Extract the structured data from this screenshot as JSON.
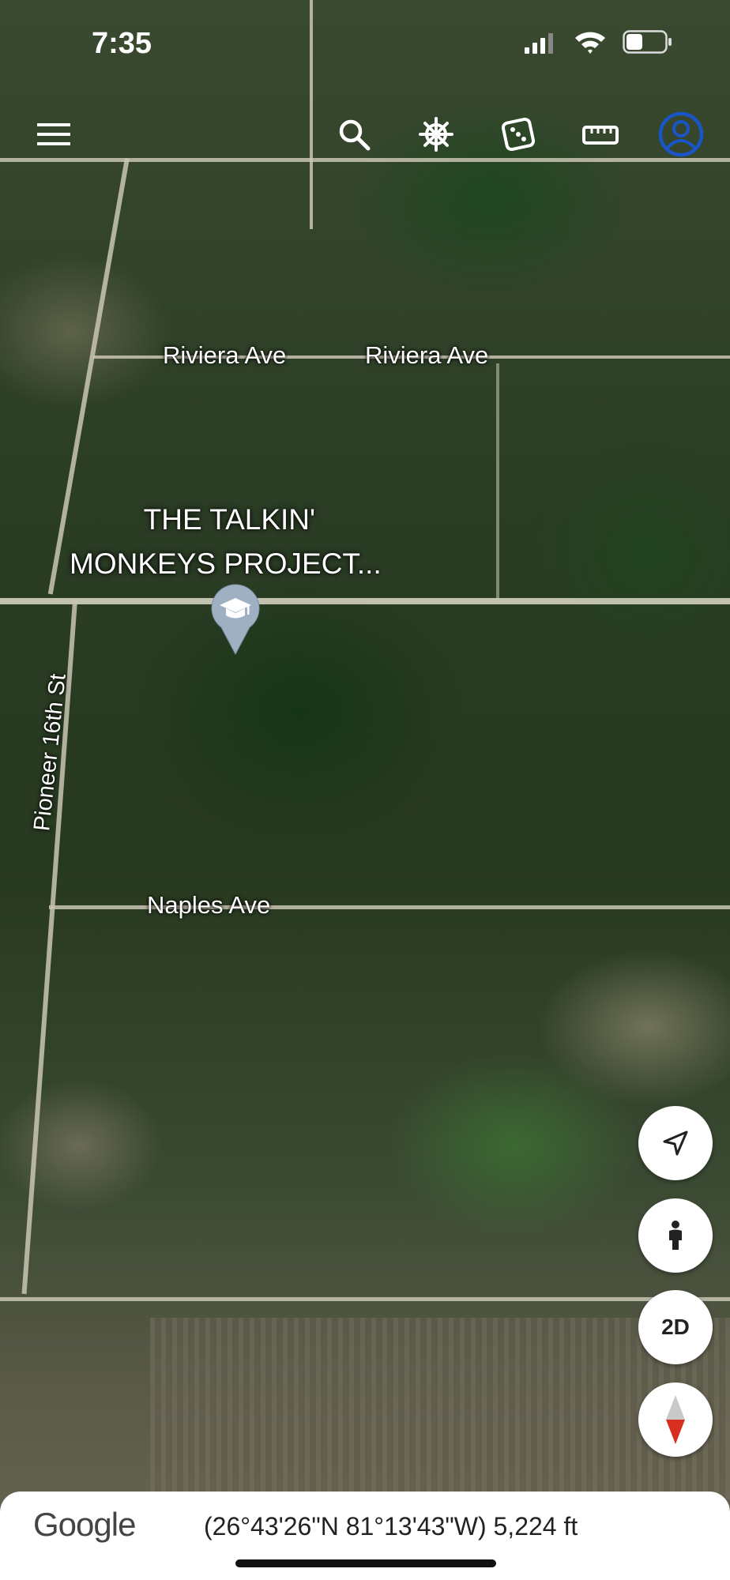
{
  "status_bar": {
    "time": "7:35",
    "icons": [
      "cellular-signal-icon",
      "wifi-icon",
      "battery-icon"
    ]
  },
  "toolbar": {
    "icons": [
      "menu-icon",
      "search-icon",
      "voyager-wheel-icon",
      "feeling-lucky-dice-icon",
      "measure-ruler-icon",
      "account-icon"
    ],
    "accent_color": "#1a55c8"
  },
  "map": {
    "type": "satellite",
    "labels": {
      "road_1": "Riviera Ave",
      "road_2": "Riviera Ave",
      "road_3": "Pioneer 16th St",
      "road_4": "Naples Ave"
    },
    "poi": {
      "name_line1": "THE TALKIN'",
      "name_line2": "MONKEYS PROJECT...",
      "icon": "graduation-cap-icon"
    }
  },
  "controls": {
    "locate_icon": "navigation-arrow-icon",
    "street_view_icon": "pegman-icon",
    "view_mode_label": "2D",
    "compass_icon": "compass-icon"
  },
  "footer": {
    "brand": "Google",
    "coordinates": "(26°43'26\"N 81°13'43\"W) 5,224 ft"
  }
}
